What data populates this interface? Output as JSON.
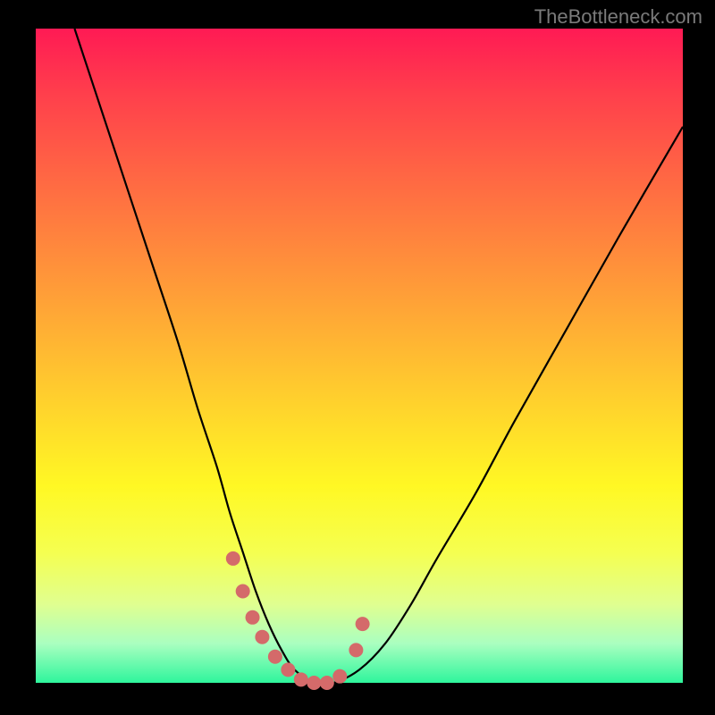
{
  "watermark": "TheBottleneck.com",
  "chart_data": {
    "type": "line",
    "title": "",
    "xlabel": "",
    "ylabel": "",
    "xlim": [
      0,
      100
    ],
    "ylim": [
      0,
      100
    ],
    "curve": {
      "name": "bottleneck-curve",
      "color": "#000000",
      "x": [
        6,
        10,
        14,
        18,
        22,
        25,
        28,
        30,
        32,
        34,
        36,
        38,
        40,
        43,
        46,
        50,
        54,
        58,
        62,
        68,
        74,
        82,
        90,
        100
      ],
      "y": [
        100,
        88,
        76,
        64,
        52,
        42,
        33,
        26,
        20,
        14,
        9,
        5,
        2,
        0,
        0,
        2,
        6,
        12,
        19,
        29,
        40,
        54,
        68,
        85
      ]
    },
    "markers": {
      "name": "highlight-points",
      "color": "#d46a6a",
      "radius": 8,
      "x": [
        30.5,
        32,
        33.5,
        35,
        37,
        39,
        41,
        43,
        45,
        47,
        49.5,
        50.5
      ],
      "y": [
        19,
        14,
        10,
        7,
        4,
        2,
        0.5,
        0,
        0,
        1,
        5,
        9
      ]
    },
    "gradient_stops": [
      {
        "pos": 0,
        "color": "#ff1a54"
      },
      {
        "pos": 70,
        "color": "#fff824"
      },
      {
        "pos": 100,
        "color": "#2ef59c"
      }
    ]
  }
}
